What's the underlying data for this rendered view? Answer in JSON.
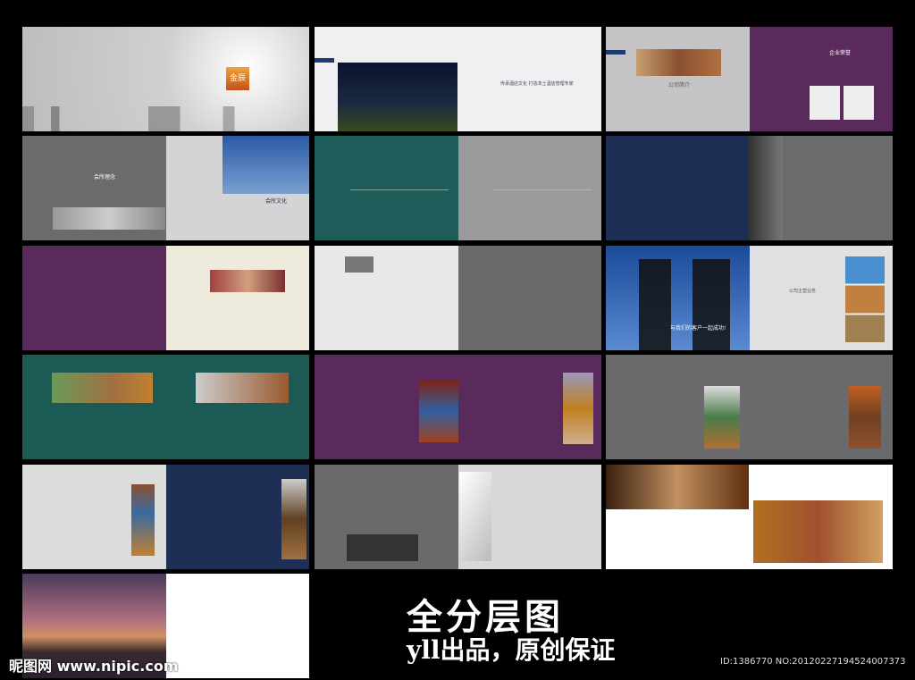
{
  "panels": {
    "cover": {
      "logo": "金辰"
    },
    "intro": {
      "slogan": "传承酒店文化 打造本土酒店管理专家"
    },
    "company": {
      "heading1": "公司简介",
      "heading2": "企业荣誉"
    },
    "club": {
      "heading1": "会所理念",
      "heading2": "会所文化"
    },
    "success": {
      "tagline": "与我们的客户一起成功!",
      "heading": "公司主营业务"
    }
  },
  "footer": {
    "title": "全分层图",
    "subtitle": "yll出品，原创保证",
    "watermark": "昵图网 www.nipic.com",
    "id": "ID:1386770 NO:20120227194524007373"
  },
  "colors": {
    "purple": "#5a2a5c",
    "teal": "#1c5a56",
    "navy": "#1e2e55",
    "gray": "#6a6a6c",
    "orange": "#d9701a"
  }
}
